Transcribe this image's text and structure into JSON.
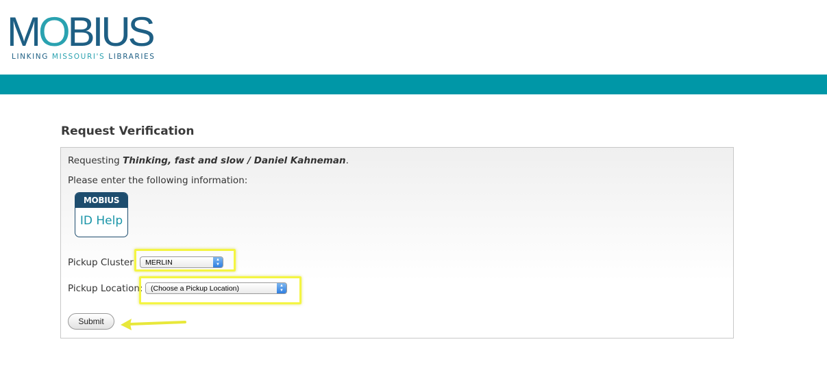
{
  "header": {
    "logo_word_left": "M",
    "logo_word_o": "O",
    "logo_word_right": "BIUS",
    "tagline_part1": "LINKING ",
    "tagline_part2": "MISSOURI'S",
    "tagline_part3": " LIBRARIES"
  },
  "colors": {
    "brand_teal": "#0097a7",
    "brand_dark": "#1e5f84",
    "highlight_yellow": "#f4f542"
  },
  "page": {
    "title": "Request Verification"
  },
  "request": {
    "prefix": "Requesting ",
    "item_title": "Thinking, fast and slow / Daniel Kahneman",
    "suffix": ".",
    "instructions": "Please enter the following information:"
  },
  "id_help": {
    "top_label": "MOBIUS",
    "bottom_label": "ID Help"
  },
  "form": {
    "cluster_label": "Pickup Cluster:",
    "cluster_value": "MERLIN",
    "location_label": "Pickup Location:",
    "location_value": "(Choose a Pickup Location)",
    "submit_label": "Submit"
  },
  "icons": {
    "select_arrows": "up-down-arrows-icon",
    "annotation": "yellow-arrow-icon"
  }
}
